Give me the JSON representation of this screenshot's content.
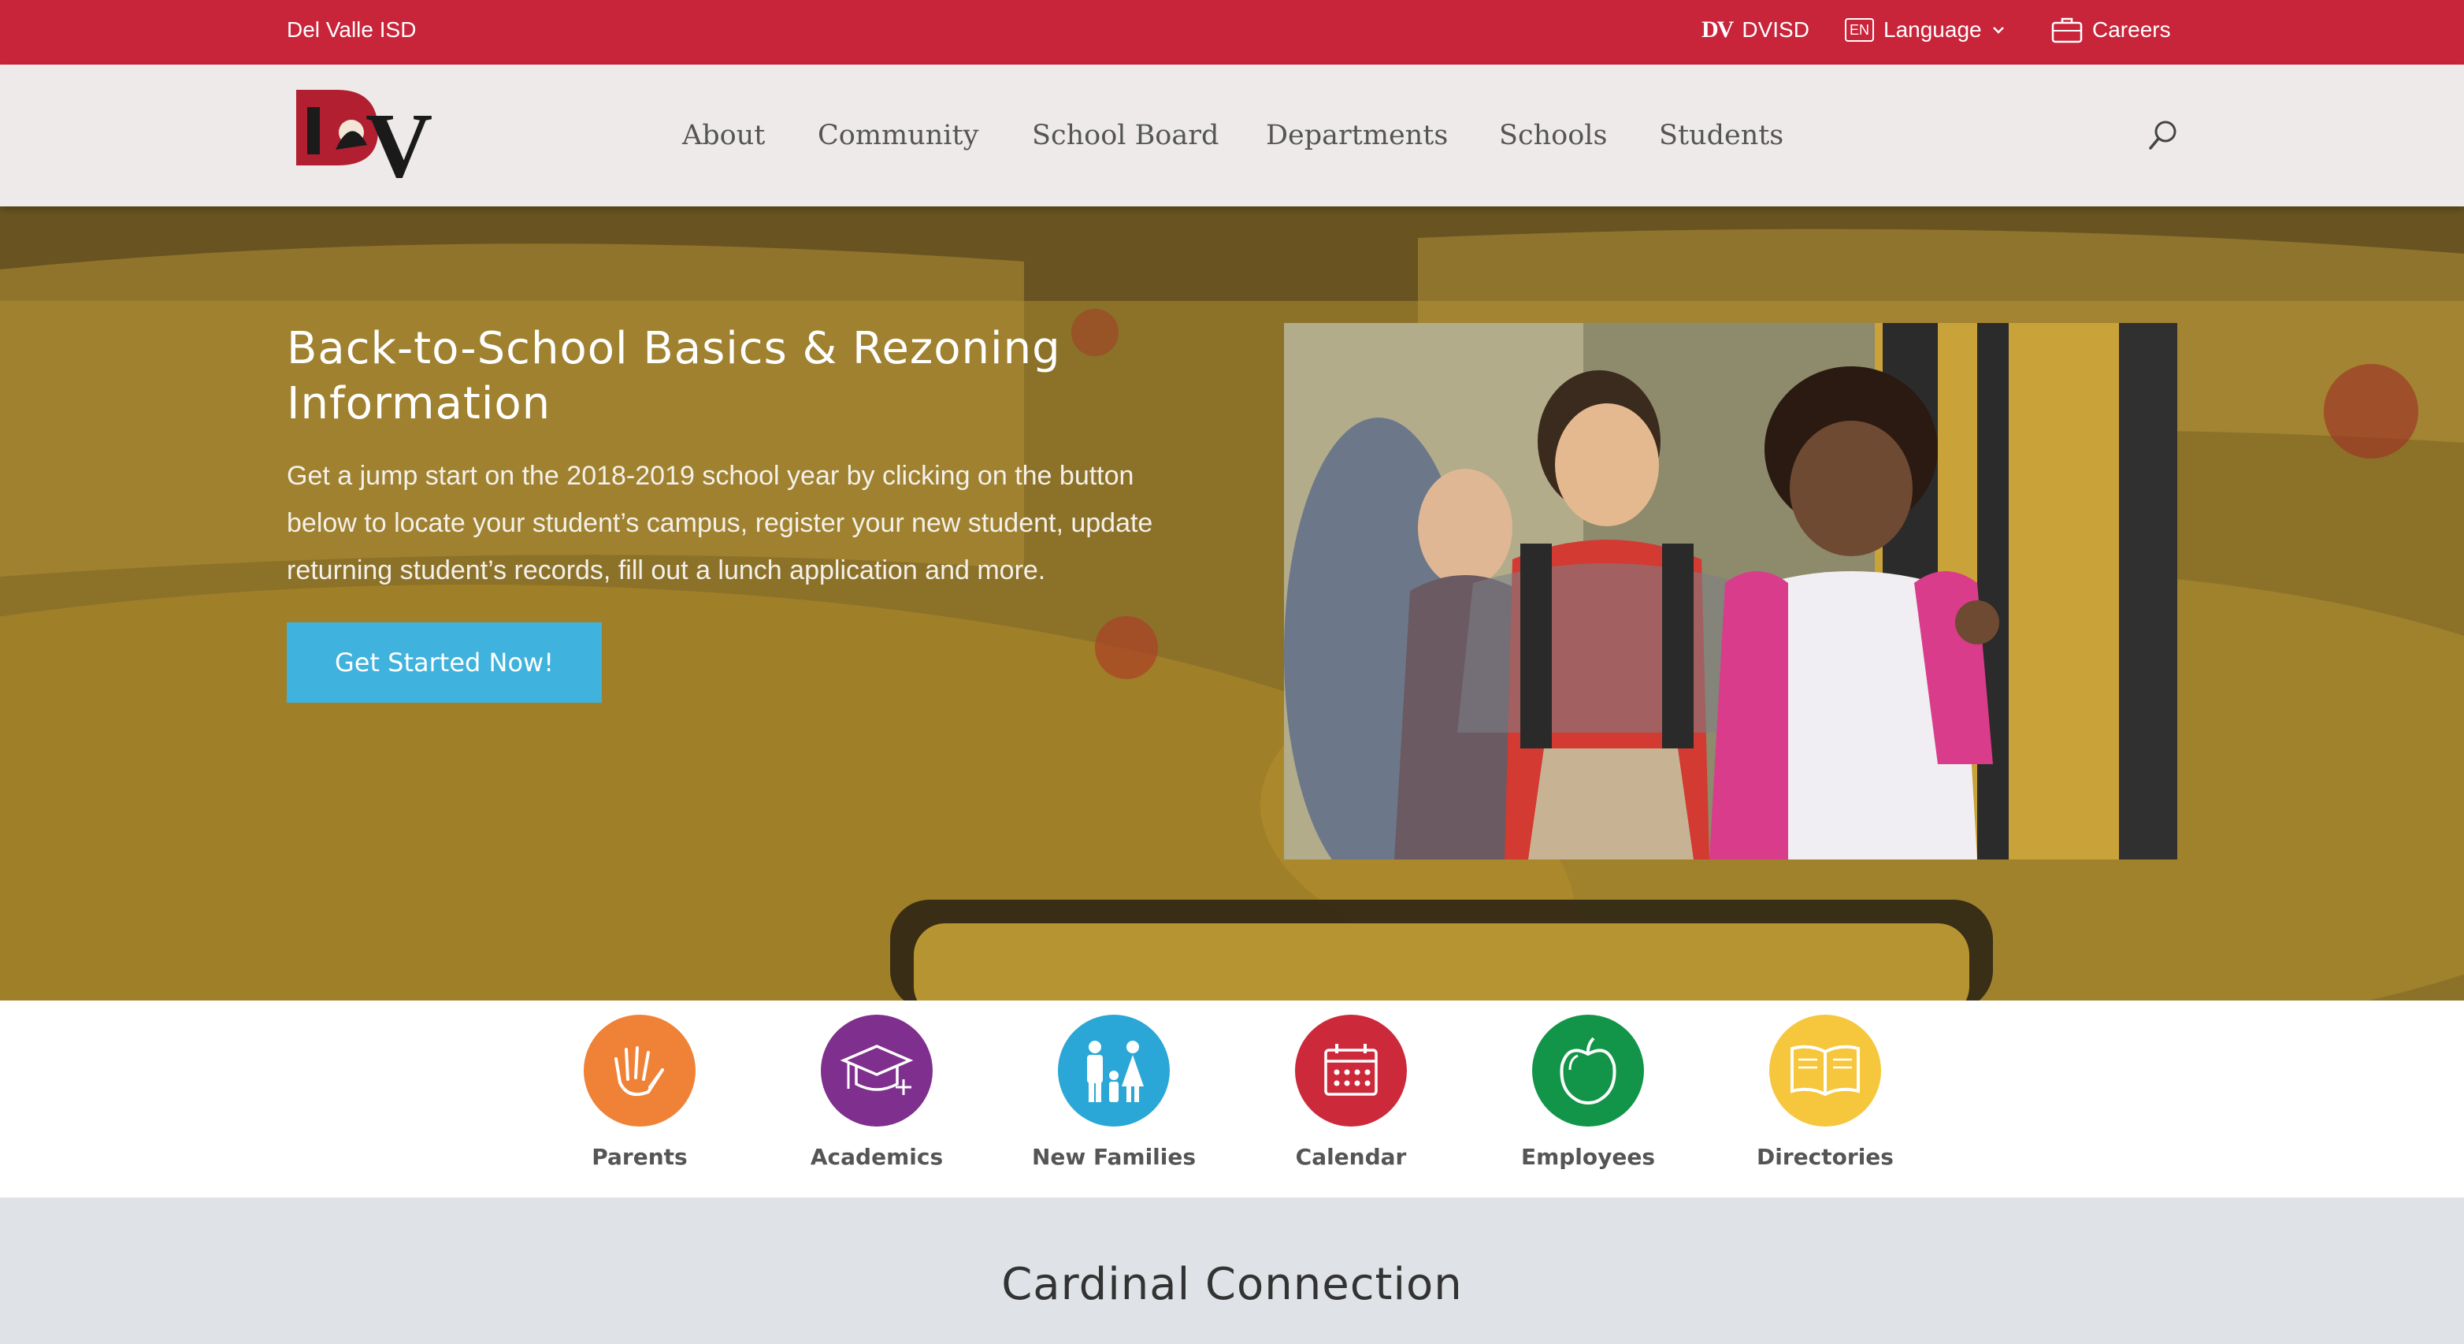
{
  "topbar": {
    "district_name": "Del Valle ISD",
    "dvisd_logo_text": "DV",
    "dvisd_label": "DVISD",
    "language_badge": "EN",
    "language_label": "Language",
    "careers_label": "Careers",
    "background_color": "#c8243a"
  },
  "header": {
    "nav": [
      "About",
      "Community",
      "School Board",
      "Departments",
      "Schools",
      "Students"
    ]
  },
  "hero": {
    "title": "Back-to-School Basics & Rezoning Information",
    "description": "Get a jump start on the 2018-2019 school year by clicking on the button below to locate your student’s campus, register your new student, update returning student’s records, fill out a lunch application and more.",
    "cta_label": "Get Started Now!",
    "cta_color": "#3fb2dd"
  },
  "quick_links": [
    {
      "label": "Parents",
      "icon": "hands-icon",
      "color": "#ef8236"
    },
    {
      "label": "Academics",
      "icon": "graduation-cap-icon",
      "color": "#7f2f8d"
    },
    {
      "label": "New Families",
      "icon": "family-icon",
      "color": "#2aa7d6"
    },
    {
      "label": "Calendar",
      "icon": "calendar-icon",
      "color": "#cc2a3a"
    },
    {
      "label": "Employees",
      "icon": "apple-icon",
      "color": "#129548"
    },
    {
      "label": "Directories",
      "icon": "book-icon",
      "color": "#f6c73d"
    }
  ],
  "cardinal": {
    "heading": "Cardinal Connection"
  }
}
